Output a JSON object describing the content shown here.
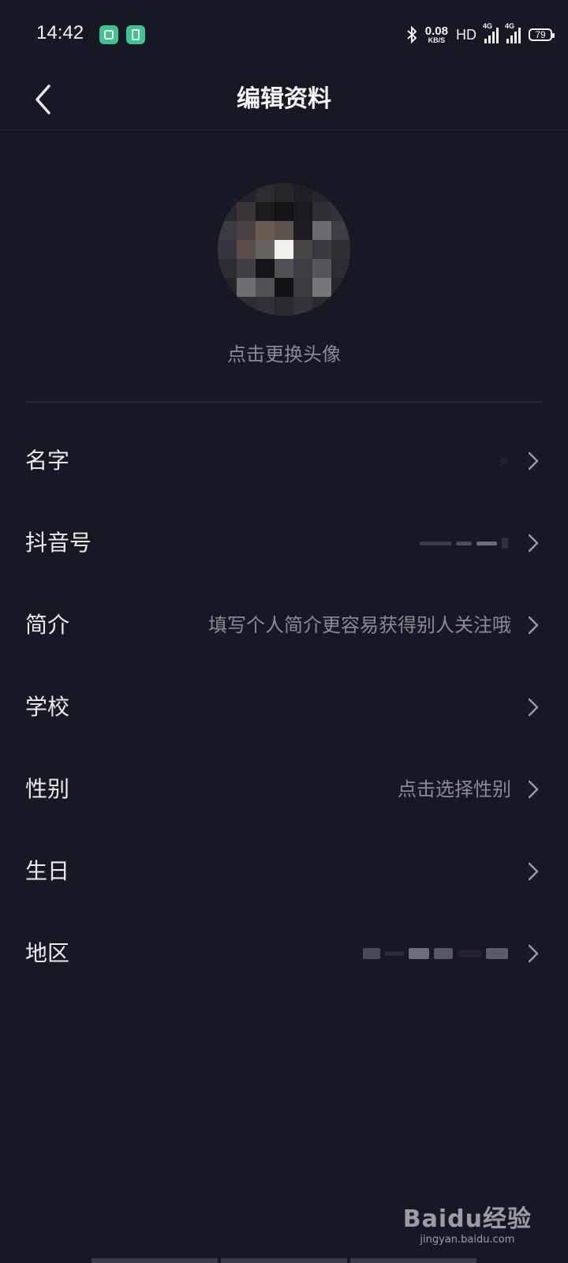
{
  "status_bar": {
    "time": "14:42",
    "net_speed": "0.08",
    "net_unit": "KB/S",
    "hd_label": "HD",
    "sim1_label": "4G",
    "sim2_label": "4G",
    "battery": "79"
  },
  "nav": {
    "title": "编辑资料",
    "back_icon": "chevron-left-icon"
  },
  "avatar": {
    "change_text": "点击更换头像"
  },
  "fields": [
    {
      "label": "名字",
      "value": ""
    },
    {
      "label": "抖音号",
      "value": ""
    },
    {
      "label": "简介",
      "value": "填写个人简介更容易获得别人关注哦"
    },
    {
      "label": "学校",
      "value": ""
    },
    {
      "label": "性别",
      "value": "点击选择性别"
    },
    {
      "label": "生日",
      "value": ""
    },
    {
      "label": "地区",
      "value": ""
    }
  ],
  "watermark": {
    "brand": "Baidu经验",
    "url": "jingyan.baidu.com"
  },
  "colors": {
    "background": "#161823",
    "text_primary": "#ececee",
    "text_secondary": "#8a8b92",
    "divider": "#2e3039",
    "app_badge": "#3ec58f"
  }
}
